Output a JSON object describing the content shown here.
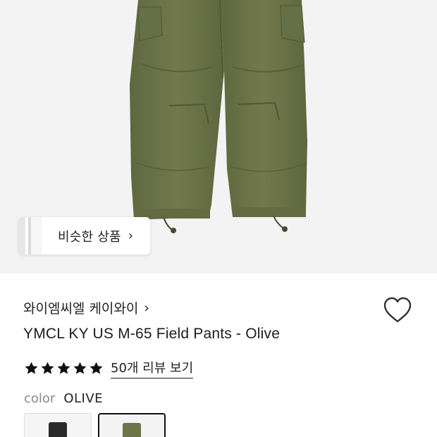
{
  "product_image": {
    "alt": ""
  },
  "similar_products": {
    "label": "비슷한 상품",
    "chevron": "›"
  },
  "brand": {
    "name": "와이엠씨엘 케이와이",
    "chevron": "›"
  },
  "wishlist": {
    "icon": "heart-icon"
  },
  "product": {
    "title": "YMCL KY US M-65 Field Pants - Olive"
  },
  "rating": {
    "stars": 5,
    "max": 5,
    "review_link": "50개 리뷰 보기"
  },
  "option": {
    "key": "color",
    "value": "OLIVE"
  },
  "swatches": [
    {
      "name": "black",
      "color": "#2a2a2a",
      "selected": false
    },
    {
      "name": "olive",
      "color": "#6c7448",
      "selected": true
    }
  ],
  "colors": {
    "pants": "#6c7448",
    "hero_bg": "#f3f3f3",
    "star": "#111111"
  }
}
